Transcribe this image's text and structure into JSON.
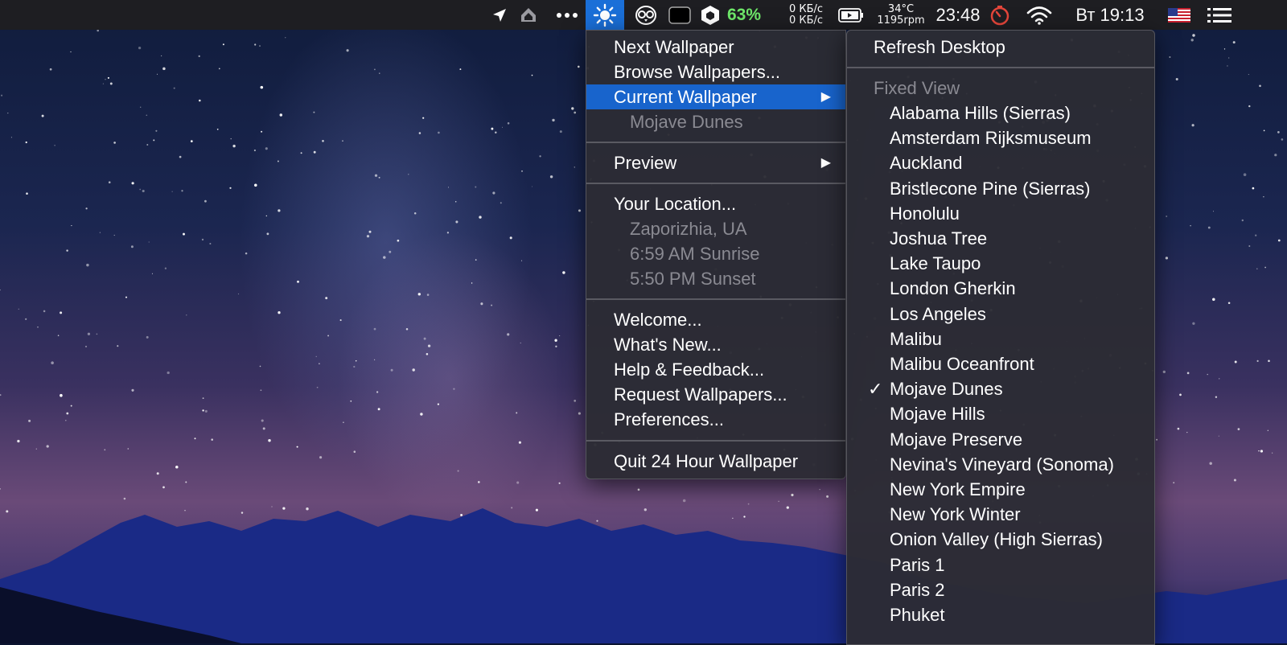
{
  "menubar": {
    "battery_percent": "63%",
    "net_up": "0 КБ/с",
    "net_down": "0 КБ/с",
    "temperature": "34°C",
    "fan_rpm": "1195rpm",
    "time": "23:48",
    "day_time": "Вт 19:13",
    "icons": [
      "location-arrow-icon",
      "dropbox-like-icon",
      "more-dots-icon",
      "sun-icon",
      "owl-icon",
      "screen-icon",
      "hex-icon",
      "battery-icon",
      "timer-icon",
      "wifi-icon",
      "us-flag-icon",
      "list-icon"
    ]
  },
  "main_menu": {
    "next_wallpaper": "Next Wallpaper",
    "browse_wallpapers": "Browse Wallpapers...",
    "current_wallpaper": "Current Wallpaper",
    "current_name": "Mojave Dunes",
    "preview": "Preview",
    "your_location": "Your Location...",
    "location_city": "Zaporizhia, UA",
    "sunrise": "6:59 AM Sunrise",
    "sunset": "5:50 PM Sunset",
    "welcome": "Welcome...",
    "whats_new": "What's New...",
    "help_feedback": "Help & Feedback...",
    "request_wallpapers": "Request Wallpapers...",
    "preferences": "Preferences...",
    "quit": "Quit 24 Hour Wallpaper",
    "submenu_arrow": "▶"
  },
  "sub_menu": {
    "refresh_desktop": "Refresh Desktop",
    "fixed_view": "Fixed View",
    "checkmark": "✓",
    "items": [
      "Alabama Hills (Sierras)",
      "Amsterdam Rijksmuseum",
      "Auckland",
      "Bristlecone Pine (Sierras)",
      "Honolulu",
      "Joshua Tree",
      "Lake Taupo",
      "London Gherkin",
      "Los Angeles",
      "Malibu",
      "Malibu Oceanfront",
      "Mojave Dunes",
      "Mojave Hills",
      "Mojave Preserve",
      "Nevina's Vineyard (Sonoma)",
      "New York Empire",
      "New York Winter",
      "Onion Valley (High Sierras)",
      "Paris 1",
      "Paris 2",
      "Phuket"
    ],
    "checked_item": "Mojave Dunes"
  }
}
